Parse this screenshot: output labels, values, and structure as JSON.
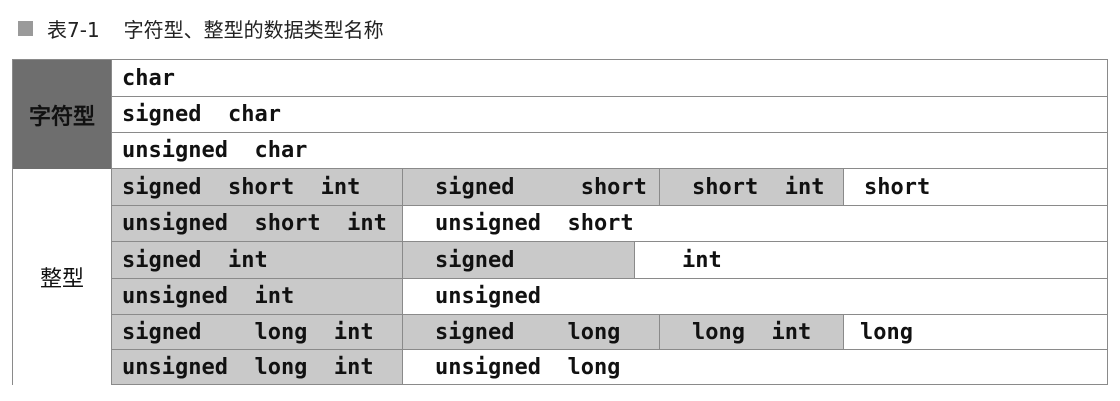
{
  "caption": {
    "number": "表7-1",
    "title": "字符型、整型的数据类型名称"
  },
  "categories": {
    "char": "字符型",
    "int": "整型"
  },
  "char_rows": [
    "char",
    "signed  char",
    "unsigned  char"
  ],
  "int_rows": [
    [
      "signed  short  int",
      "signed     short",
      "short  int",
      "short"
    ],
    [
      "unsigned  short  int",
      "unsigned  short"
    ],
    [
      "signed  int",
      "signed",
      "int"
    ],
    [
      "unsigned  int",
      "unsigned"
    ],
    [
      "signed    long  int",
      "signed    long",
      "long  int",
      "long"
    ],
    [
      "unsigned  long  int",
      "unsigned  long"
    ]
  ]
}
